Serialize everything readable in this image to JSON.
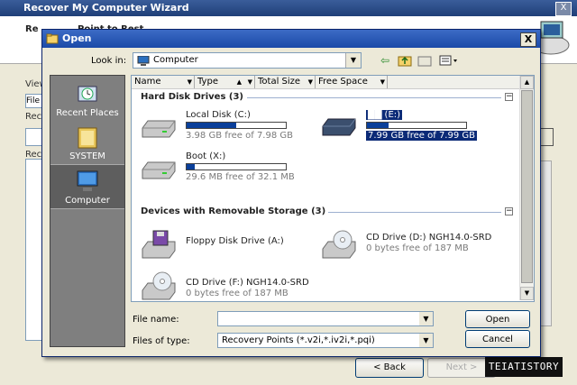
{
  "wizard": {
    "title": "Recover My Computer Wizard",
    "header_partial_left": "Re",
    "header_partial_mid": "Point to Rest",
    "field_label_1": "View",
    "field_value_1": "File",
    "field_label_2": "Reco",
    "field_label_3": "Reco",
    "back_label": "< Back",
    "next_label": "Next >",
    "close_label": "X"
  },
  "watermark": "TEIATISTORY",
  "dialog": {
    "title": "Open",
    "close_label": "X",
    "look_in_label": "Look in:",
    "look_in_value": "Computer",
    "places": [
      {
        "label": "Recent Places",
        "icon": "recent-places-icon"
      },
      {
        "label": "SYSTEM",
        "icon": "folder-icon"
      },
      {
        "label": "Computer",
        "icon": "computer-icon"
      }
    ],
    "columns": [
      "Name",
      "Type",
      "Total Size",
      "Free Space"
    ],
    "groups": [
      {
        "title": "Hard Disk Drives (3)",
        "items": [
          {
            "name": "Local Disk (C:)",
            "free": "3.98 GB free of 7.98 GB",
            "used_fraction": 0.5,
            "icon": "hard-disk-icon",
            "selected": false
          },
          {
            "name": "██ (E:)",
            "free": "7.99 GB free of 7.99 GB",
            "used_fraction": 0.22,
            "icon": "hard-disk-dark-icon",
            "selected": true
          },
          {
            "name": "Boot (X:)",
            "free": "29.6 MB free of 32.1 MB",
            "used_fraction": 0.08,
            "icon": "hard-disk-icon",
            "selected": false
          }
        ]
      },
      {
        "title": "Devices with Removable Storage (3)",
        "items": [
          {
            "name": "Floppy Disk Drive (A:)",
            "free": "",
            "icon": "floppy-drive-icon"
          },
          {
            "name": "CD Drive (D:) NGH14.0-SRD",
            "free": "0 bytes free of 187 MB",
            "icon": "cd-drive-icon"
          },
          {
            "name": "CD Drive (F:) NGH14.0-SRD",
            "free": "0 bytes free of 187 MB",
            "icon": "cd-drive-icon"
          }
        ]
      }
    ],
    "file_name_label": "File name:",
    "file_name_value": "",
    "files_of_type_label": "Files of type:",
    "files_of_type_value": "Recovery Points (*.v2i,*.iv2i,*.pqi)",
    "open_label": "Open",
    "cancel_label": "Cancel",
    "collapse_glyph": "−"
  }
}
